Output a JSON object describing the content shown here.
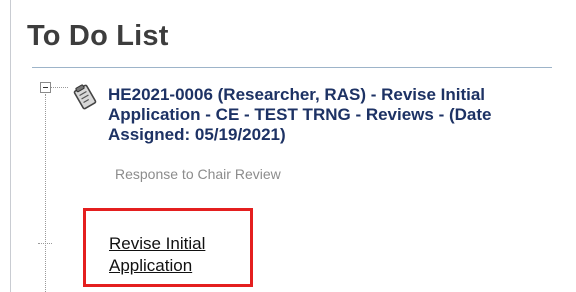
{
  "page": {
    "title": "To Do List"
  },
  "todo": {
    "item": {
      "text": "HE2021-0006 (Researcher, RAS) - Revise Initial Application - CE - TEST TRNG - Reviews - (Date Assigned: 05/19/2021)",
      "subtitle": "Response to Chair Review",
      "icon": "clipboard-icon",
      "expander_state": "expanded"
    },
    "action": {
      "label": "Revise Initial Application"
    }
  },
  "colors": {
    "title": "#3d3d3d",
    "item_text": "#1d3264",
    "subtitle": "#8c8c8c",
    "highlight": "#e41f1f",
    "rule": "#9db4c9"
  }
}
